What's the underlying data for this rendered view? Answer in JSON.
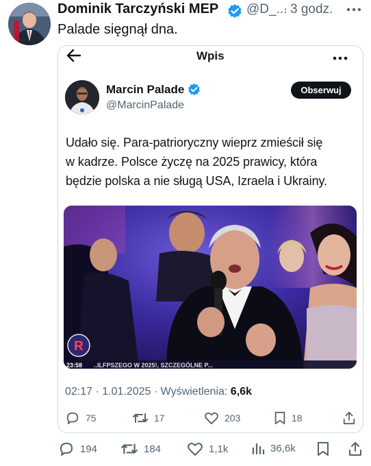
{
  "outer_tweet": {
    "author_name": "Dominik Tarczyński MEP",
    "handle": "@D_...",
    "separator": "·",
    "time": "3 godz.",
    "text": "Palade sięgnął dna."
  },
  "embedded_post": {
    "header_title": "Wpis",
    "author_name": "Marcin Palade",
    "handle": "@MarcinPalade",
    "follow_label": "Obserwuj",
    "text_lines": [
      "Udało się. Para-patrioryczny wieprz zmieścił się",
      "w kadrze. Polsce życzę na 2025 prawicy, która",
      "będzie polska a nie sługą USA, Izraela i Ukrainy."
    ],
    "media": {
      "channel_logo": "R",
      "clock": "23:58",
      "ticker": "..ILFPSZEGO W 2025!, SZCZEGÓLNE P..."
    },
    "meta": {
      "datetime": "02:17 · 1.01.2025 ·",
      "views_label": "Wyświetlenia:",
      "views_value": "6,6k"
    },
    "actions": {
      "replies": "75",
      "reposts": "17",
      "likes": "203",
      "bookmarks": "18"
    }
  },
  "outer_actions": {
    "replies": "194",
    "reposts": "184",
    "likes": "1,1k",
    "views": "36,6k"
  },
  "colors": {
    "text": "#0f1419",
    "secondary": "#536471",
    "verified": "#1d9bf0",
    "border": "#cfd9de"
  },
  "icons": [
    "verified-badge-icon",
    "more-icon",
    "back-arrow-icon",
    "reply-icon",
    "repost-icon",
    "like-icon",
    "bookmark-icon",
    "share-icon",
    "views-icon"
  ]
}
